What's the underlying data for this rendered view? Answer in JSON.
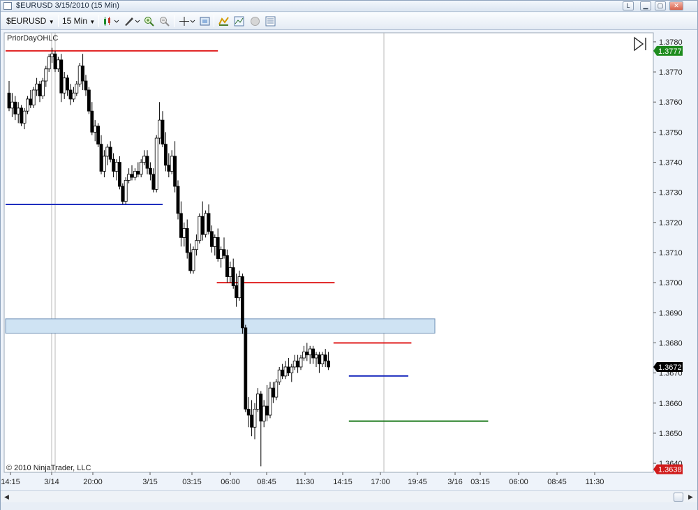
{
  "window": {
    "title": "$EURUSD  3/15/2010 (15 Min)",
    "buttons": {
      "link": "L",
      "minimize": "▁",
      "maximize": "▢",
      "close": "✕"
    }
  },
  "toolbar": {
    "instrument": "$EURUSD",
    "interval": "15 Min",
    "icons": [
      "chart-style-icon",
      "draw-tools-icon",
      "zoom-in-icon",
      "zoom-out-icon",
      "crosshair-icon",
      "snapshot-icon",
      "strategies-icon",
      "indicators-icon",
      "hide-icon",
      "properties-icon"
    ]
  },
  "chart": {
    "indicator_label": "PriorDayOHLC",
    "copyright": "© 2010 NinjaTrader, LLC",
    "price_ticks": [
      "1.3780",
      "1.3770",
      "1.3760",
      "1.3750",
      "1.3740",
      "1.3730",
      "1.3720",
      "1.3710",
      "1.3700",
      "1.3690",
      "1.3680",
      "1.3670",
      "1.3660",
      "1.3650",
      "1.3640"
    ],
    "time_ticks": [
      "14:15",
      "3/14",
      "20:00",
      "3/15",
      "03:15",
      "06:00",
      "08:45",
      "11:30",
      "14:15",
      "17:00",
      "19:45",
      "3/16",
      "03:15",
      "06:00",
      "08:45",
      "11:30"
    ],
    "markers": [
      {
        "label": "1.3777",
        "price": 1.3777,
        "color": "#1e8c1e"
      },
      {
        "label": "1.3672",
        "price": 1.3672,
        "color": "#000000"
      },
      {
        "label": "1.3638",
        "price": 1.3638,
        "color": "#d01b1b"
      }
    ],
    "colors": {
      "up": "#ffffff",
      "down": "#000000",
      "high": "#e02020",
      "low": "#1f2fbf",
      "close": "#1e7a1e",
      "zone": "#cfe3f3"
    }
  },
  "chart_data": {
    "type": "candlestick",
    "ylim": [
      1.3637,
      1.3783
    ],
    "levels": [
      {
        "name": "high",
        "price": 1.3777,
        "from": 0,
        "to": 68
      },
      {
        "name": "low",
        "price": 1.3726,
        "from": 0,
        "to": 50
      },
      {
        "name": "high",
        "price": 1.37,
        "from": 69,
        "to": 106
      },
      {
        "name": "high",
        "price": 1.368,
        "from": 107,
        "to": 131
      },
      {
        "name": "low",
        "price": 1.3669,
        "from": 112,
        "to": 130
      },
      {
        "name": "close",
        "price": 1.3654,
        "from": 112,
        "to": 156
      }
    ],
    "zone": {
      "from_price": 1.3688,
      "to_price": 1.3686
    },
    "candles": [
      [
        1.3763,
        1.3767,
        1.3757,
        1.3758
      ],
      [
        1.3758,
        1.3763,
        1.3755,
        1.376
      ],
      [
        1.376,
        1.3762,
        1.3754,
        1.3756
      ],
      [
        1.3756,
        1.376,
        1.3753,
        1.3758
      ],
      [
        1.3758,
        1.3759,
        1.3752,
        1.3753
      ],
      [
        1.3753,
        1.3758,
        1.3751,
        1.3757
      ],
      [
        1.3757,
        1.3762,
        1.3756,
        1.3761
      ],
      [
        1.3761,
        1.3764,
        1.3758,
        1.3759
      ],
      [
        1.3759,
        1.3765,
        1.3758,
        1.3764
      ],
      [
        1.3764,
        1.3768,
        1.3762,
        1.3766
      ],
      [
        1.3766,
        1.3767,
        1.376,
        1.3762
      ],
      [
        1.3762,
        1.3768,
        1.3761,
        1.3767
      ],
      [
        1.3767,
        1.3772,
        1.3765,
        1.3771
      ],
      [
        1.3771,
        1.3776,
        1.377,
        1.3775
      ],
      [
        1.3775,
        1.3778,
        1.3773,
        1.3776
      ],
      [
        1.3776,
        1.3777,
        1.377,
        1.3771
      ],
      [
        1.3771,
        1.3775,
        1.377,
        1.3774
      ],
      [
        1.3774,
        1.3776,
        1.376,
        1.3763
      ],
      [
        1.3763,
        1.377,
        1.3761,
        1.3768
      ],
      [
        1.3768,
        1.3769,
        1.3762,
        1.3764
      ],
      [
        1.3764,
        1.3766,
        1.3759,
        1.3761
      ],
      [
        1.3761,
        1.3765,
        1.376,
        1.3763
      ],
      [
        1.3763,
        1.3767,
        1.3762,
        1.3766
      ],
      [
        1.3766,
        1.3773,
        1.3765,
        1.3772
      ],
      [
        1.3772,
        1.3776,
        1.3764,
        1.3767
      ],
      [
        1.3767,
        1.3769,
        1.3762,
        1.3764
      ],
      [
        1.3764,
        1.3765,
        1.3756,
        1.3757
      ],
      [
        1.3757,
        1.376,
        1.3749,
        1.375
      ],
      [
        1.375,
        1.3754,
        1.3747,
        1.3752
      ],
      [
        1.3752,
        1.3753,
        1.3745,
        1.3746
      ],
      [
        1.3746,
        1.3749,
        1.3736,
        1.3737
      ],
      [
        1.3737,
        1.3744,
        1.3735,
        1.3742
      ],
      [
        1.3742,
        1.3746,
        1.3739,
        1.3745
      ],
      [
        1.3745,
        1.3747,
        1.374,
        1.3741
      ],
      [
        1.3741,
        1.3743,
        1.3735,
        1.3737
      ],
      [
        1.3737,
        1.3741,
        1.3734,
        1.374
      ],
      [
        1.374,
        1.3742,
        1.3731,
        1.3732
      ],
      [
        1.3732,
        1.3733,
        1.3726,
        1.3727
      ],
      [
        1.3727,
        1.3735,
        1.3726,
        1.3734
      ],
      [
        1.3734,
        1.3738,
        1.3733,
        1.3736
      ],
      [
        1.3736,
        1.3739,
        1.3734,
        1.3735
      ],
      [
        1.3735,
        1.3738,
        1.3734,
        1.3737
      ],
      [
        1.3737,
        1.374,
        1.3735,
        1.3736
      ],
      [
        1.3736,
        1.3741,
        1.3735,
        1.374
      ],
      [
        1.374,
        1.3744,
        1.3739,
        1.3742
      ],
      [
        1.3742,
        1.3744,
        1.3736,
        1.3738
      ],
      [
        1.3738,
        1.374,
        1.3734,
        1.3736
      ],
      [
        1.3736,
        1.3738,
        1.373,
        1.3731
      ],
      [
        1.3731,
        1.3749,
        1.373,
        1.3748
      ],
      [
        1.3748,
        1.376,
        1.3746,
        1.3754
      ],
      [
        1.3754,
        1.3757,
        1.3745,
        1.3746
      ],
      [
        1.3746,
        1.375,
        1.3737,
        1.3739
      ],
      [
        1.3739,
        1.3743,
        1.3735,
        1.3737
      ],
      [
        1.3737,
        1.3744,
        1.3736,
        1.3742
      ],
      [
        1.3742,
        1.3747,
        1.373,
        1.3732
      ],
      [
        1.3732,
        1.3734,
        1.3721,
        1.3723
      ],
      [
        1.3723,
        1.3727,
        1.3712,
        1.3715
      ],
      [
        1.3715,
        1.372,
        1.3712,
        1.3718
      ],
      [
        1.3718,
        1.3721,
        1.3708,
        1.371
      ],
      [
        1.371,
        1.3713,
        1.3703,
        1.3704
      ],
      [
        1.3704,
        1.3712,
        1.3703,
        1.3711
      ],
      [
        1.3711,
        1.3716,
        1.3709,
        1.3714
      ],
      [
        1.3714,
        1.3723,
        1.3713,
        1.3722
      ],
      [
        1.3722,
        1.3727,
        1.3714,
        1.3716
      ],
      [
        1.3716,
        1.3724,
        1.3715,
        1.3723
      ],
      [
        1.3723,
        1.3726,
        1.3716,
        1.3717
      ],
      [
        1.3717,
        1.3719,
        1.371,
        1.3712
      ],
      [
        1.3712,
        1.3716,
        1.3709,
        1.3715
      ],
      [
        1.3715,
        1.3718,
        1.3707,
        1.3708
      ],
      [
        1.3708,
        1.3712,
        1.3705,
        1.3711
      ],
      [
        1.3711,
        1.3715,
        1.3708,
        1.3709
      ],
      [
        1.3709,
        1.3711,
        1.37,
        1.3702
      ],
      [
        1.3702,
        1.3707,
        1.37,
        1.3705
      ],
      [
        1.3705,
        1.3708,
        1.3698,
        1.3699
      ],
      [
        1.3699,
        1.3703,
        1.3692,
        1.3695
      ],
      [
        1.3695,
        1.3704,
        1.3694,
        1.3702
      ],
      [
        1.3702,
        1.3703,
        1.3683,
        1.3685
      ],
      [
        1.3685,
        1.3686,
        1.3657,
        1.3658
      ],
      [
        1.3658,
        1.3662,
        1.3652,
        1.3656
      ],
      [
        1.3656,
        1.3661,
        1.3649,
        1.3652
      ],
      [
        1.3652,
        1.366,
        1.3648,
        1.3658
      ],
      [
        1.3658,
        1.3665,
        1.3657,
        1.3663
      ],
      [
        1.3663,
        1.3664,
        1.3639,
        1.3654
      ],
      [
        1.3654,
        1.3661,
        1.3652,
        1.3659
      ],
      [
        1.3659,
        1.3666,
        1.3654,
        1.3656
      ],
      [
        1.3656,
        1.3667,
        1.3655,
        1.3665
      ],
      [
        1.3665,
        1.3667,
        1.366,
        1.3662
      ],
      [
        1.3662,
        1.3668,
        1.3661,
        1.3667
      ],
      [
        1.3667,
        1.3672,
        1.3666,
        1.3671
      ],
      [
        1.3671,
        1.3673,
        1.3668,
        1.3669
      ],
      [
        1.3669,
        1.3674,
        1.3668,
        1.3672
      ],
      [
        1.3672,
        1.3675,
        1.3669,
        1.367
      ],
      [
        1.367,
        1.3673,
        1.3667,
        1.3672
      ],
      [
        1.3672,
        1.3676,
        1.3671,
        1.3674
      ],
      [
        1.3674,
        1.3676,
        1.367,
        1.3672
      ],
      [
        1.3672,
        1.3676,
        1.3671,
        1.3675
      ],
      [
        1.3675,
        1.3679,
        1.3674,
        1.3677
      ],
      [
        1.3677,
        1.368,
        1.3674,
        1.3676
      ],
      [
        1.3676,
        1.3679,
        1.3673,
        1.3678
      ],
      [
        1.3678,
        1.3679,
        1.3673,
        1.3675
      ],
      [
        1.3675,
        1.3677,
        1.3672,
        1.3676
      ],
      [
        1.3676,
        1.3677,
        1.367,
        1.3673
      ],
      [
        1.3673,
        1.3677,
        1.3672,
        1.3676
      ],
      [
        1.3676,
        1.3678,
        1.3672,
        1.3674
      ],
      [
        1.3674,
        1.3677,
        1.3671,
        1.3672
      ]
    ]
  }
}
